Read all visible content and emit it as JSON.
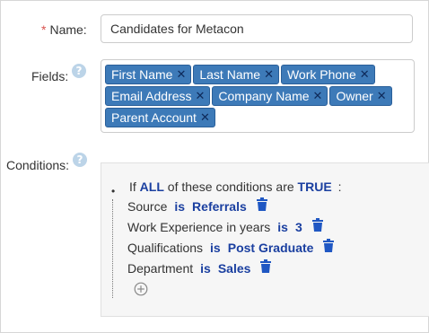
{
  "form": {
    "name": {
      "required_mark": "*",
      "label": "Name:",
      "value": "Candidates for Metacon"
    },
    "fields": {
      "label": "Fields:",
      "help_icon": "question-icon",
      "tags": [
        {
          "label": "First Name"
        },
        {
          "label": "Last Name"
        },
        {
          "label": "Work Phone"
        },
        {
          "label": "Email Address"
        },
        {
          "label": "Company Name"
        },
        {
          "label": "Owner"
        },
        {
          "label": "Parent Account"
        }
      ],
      "remove_glyph": "✕"
    },
    "conditions": {
      "label": "Conditions:",
      "help_icon": "question-icon",
      "header": {
        "bullet": "•",
        "prefix": "If",
        "quantifier": "ALL",
        "middle": "of these conditions are",
        "truth": "TRUE",
        "suffix": ":"
      },
      "rows": [
        {
          "field": "Source",
          "op": "is",
          "value": "Referrals"
        },
        {
          "field": "Work Experience in years",
          "op": "is",
          "value": "3"
        },
        {
          "field": "Qualifications",
          "op": "is",
          "value": "Post Graduate"
        },
        {
          "field": "Department",
          "op": "is",
          "value": "Sales"
        }
      ],
      "add_icon": "plus-circle-icon",
      "delete_icon": "trash-icon"
    }
  },
  "colors": {
    "tag_bg": "#3d7ab8",
    "keyword": "#1a3fa0",
    "required": "#d9534f",
    "trash": "#1f57c3"
  }
}
